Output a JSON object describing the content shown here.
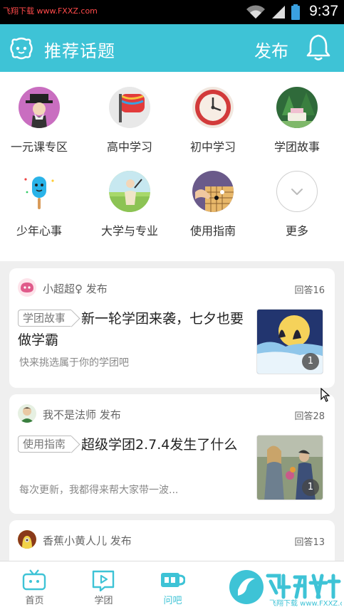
{
  "status_bar": {
    "watermark": "飞翔下载 www.FXXZ.com",
    "time": "9:37"
  },
  "header": {
    "title": "推荐话题",
    "publish": "发布",
    "accent": "#3ec3d6"
  },
  "categories": [
    {
      "label": "一元课专区",
      "icon": "man-in-hat-icon"
    },
    {
      "label": "高中学习",
      "icon": "red-flag-icon"
    },
    {
      "label": "初中学习",
      "icon": "clock-icon"
    },
    {
      "label": "学团故事",
      "icon": "forest-cake-icon"
    },
    {
      "label": "少年心事",
      "icon": "popsicle-icon"
    },
    {
      "label": "大学与专业",
      "icon": "graduate-icon"
    },
    {
      "label": "使用指南",
      "icon": "go-board-icon"
    },
    {
      "label": "更多",
      "icon": "chevron-down-icon"
    }
  ],
  "posts": [
    {
      "user": "小超超♀ 发布",
      "answers": "回答16",
      "tag": "学团故事",
      "title": "新一轮学团来袭，七夕也要做学霸",
      "desc": "快来挑选属于你的学团吧",
      "image_count": "1"
    },
    {
      "user": "我不是法师 发布",
      "answers": "回答28",
      "tag": "使用指南",
      "title": "超级学团2.7.4发生了什么",
      "desc": "每次更新，我都得来帮大家带一波...",
      "image_count": "1"
    },
    {
      "user": "香蕉小黄人儿 发布",
      "answers": "回答13"
    }
  ],
  "tabs": [
    {
      "label": "首页",
      "icon": "tv-icon"
    },
    {
      "label": "学团",
      "icon": "play-icon"
    },
    {
      "label": "问吧",
      "icon": "chat-cup-icon"
    }
  ],
  "bottom_watermark": "飞翔下载 www.FXXZ.com"
}
